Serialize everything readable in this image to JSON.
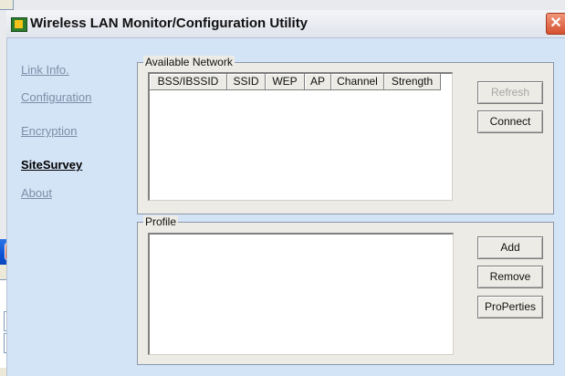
{
  "window": {
    "title": "Wireless LAN Monitor/Configuration Utility",
    "close_glyph": "✕"
  },
  "background_window": {
    "close_glyph": "✕"
  },
  "nav": {
    "items": [
      {
        "label": "Link Info.",
        "active": false
      },
      {
        "label": "Configuration",
        "active": false
      },
      {
        "label": "Encryption",
        "active": false
      },
      {
        "label": "SiteSurvey",
        "active": true
      },
      {
        "label": "About",
        "active": false
      }
    ]
  },
  "available_network": {
    "legend": "Available Network",
    "columns": [
      "BSS/IBSSID",
      "SSID",
      "WEP",
      "AP",
      "Channel",
      "Strength"
    ],
    "rows": [],
    "refresh_label": "Refresh",
    "connect_label": "Connect"
  },
  "profile": {
    "legend": "Profile",
    "items": [],
    "add_label": "Add",
    "remove_label": "Remove",
    "properties_label": "ProPerties"
  }
}
